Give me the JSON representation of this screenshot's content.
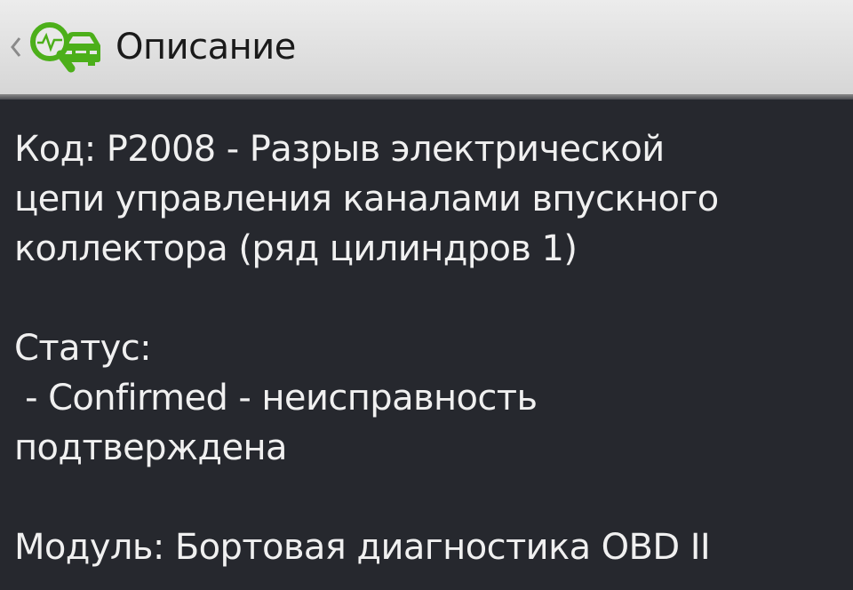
{
  "header": {
    "title": "Описание",
    "back_icon": "chevron-left-icon",
    "app_icon": "car-diagnostic-search-icon",
    "accent_color": "#4caf1a"
  },
  "description": {
    "code_line_1": "Код: P2008 - Разрыв электрической",
    "code_line_2": "цепи управления каналами впускного",
    "code_line_3": "коллектора (ряд цилиндров 1)",
    "status_label": "Статус:",
    "status_line_1": " - Confirmed - неисправность",
    "status_line_2": "подтверждена",
    "module_line": "Модуль: Бортовая диагностика OBD II"
  }
}
